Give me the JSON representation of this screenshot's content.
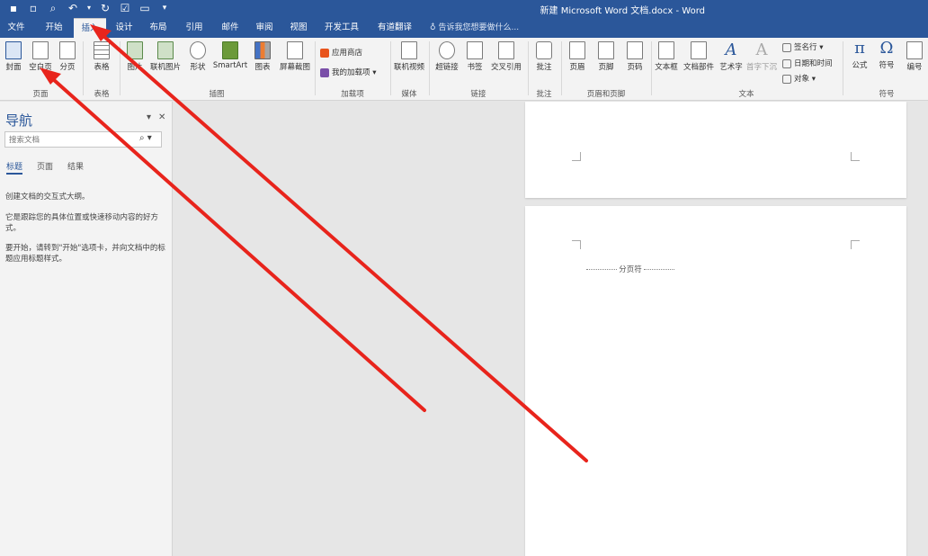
{
  "titlebar": {
    "title": "新建 Microsoft Word 文档.docx - Word",
    "qat": [
      {
        "name": "save-icon",
        "glyph": "▪"
      },
      {
        "name": "new-doc-icon",
        "glyph": "▫"
      },
      {
        "name": "print-preview-icon",
        "glyph": "⌕"
      },
      {
        "name": "undo-icon",
        "glyph": "↶"
      },
      {
        "name": "redo-icon",
        "glyph": "↻"
      },
      {
        "name": "checklist-icon",
        "glyph": "☑"
      },
      {
        "name": "open-folder-icon",
        "glyph": "▭"
      },
      {
        "name": "customize-qat-icon",
        "glyph": "▾"
      }
    ]
  },
  "tabs": {
    "file": "文件",
    "home": "开始",
    "insert": "插入",
    "design": "设计",
    "layout": "布局",
    "references": "引用",
    "mailings": "邮件",
    "review": "审阅",
    "view": "视图",
    "developer": "开发工具",
    "youdao": "有道翻译",
    "tellme": "告诉我您想要做什么..."
  },
  "ribbon": {
    "cover": "封面",
    "blank_page": "空白页",
    "page_break": "分页",
    "table": "表格",
    "picture": "图片",
    "online_pictures": "联机图片",
    "shapes": "形状",
    "smartart": "SmartArt",
    "chart": "图表",
    "screenshot": "屏幕截图",
    "store": "应用商店",
    "my_addins": "我的加载项",
    "online_video": "联机视频",
    "hyperlink": "超链接",
    "bookmark": "书签",
    "cross_reference": "交叉引用",
    "comment": "批注",
    "header": "页眉",
    "footer": "页脚",
    "page_number": "页码",
    "textbox": "文本框",
    "quick_parts": "文档部件",
    "wordart": "艺术字",
    "dropcap": "首字下沉",
    "signature_line": "签名行",
    "date_time": "日期和时间",
    "object": "对象",
    "equation": "公式",
    "symbol": "符号",
    "number": "编号",
    "groups": {
      "pages": "页面",
      "tables": "表格",
      "illustrations": "插图",
      "addins": "加载项",
      "media": "媒体",
      "links": "链接",
      "comments": "批注",
      "header_footer": "页眉和页脚",
      "text": "文本",
      "symbols": "符号"
    }
  },
  "navpane": {
    "title": "导航",
    "search_placeholder": "搜索文档",
    "tabs": [
      "标题",
      "页面",
      "结果"
    ],
    "text1": "创建文档的交互式大纲。",
    "text2": "它是跟踪您的具体位置或快速移动内容的好方式。",
    "text3": "要开始，请转到\"开始\"选项卡，并向文档中的标题应用标题样式。"
  },
  "document": {
    "page_break_label": "分页符"
  },
  "colors": {
    "accent": "#2b579a",
    "annotation_arrow": "#e8241c"
  }
}
